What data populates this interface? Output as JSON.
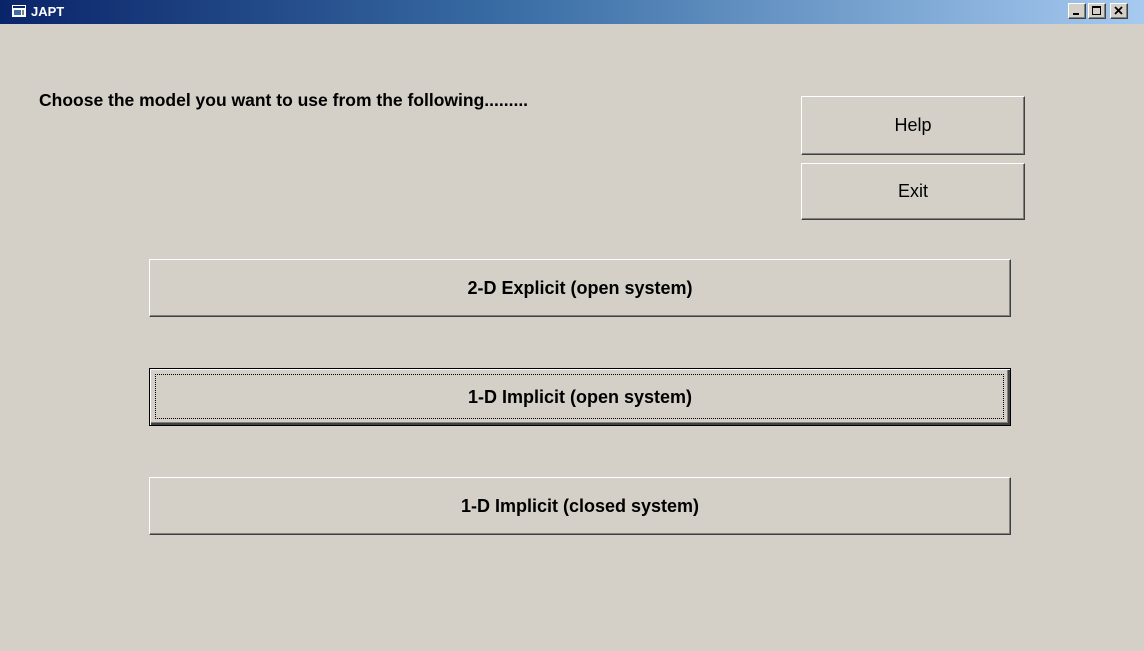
{
  "window": {
    "title": "JAPT",
    "controls": {
      "minimize_icon": "minimize-icon",
      "maximize_icon": "maximize-icon",
      "close_icon": "close-icon"
    }
  },
  "main": {
    "prompt": "Choose the model you want to use from the following.........",
    "help_label": "Help",
    "exit_label": "Exit",
    "models": [
      "2-D Explicit (open system)",
      "1-D Implicit (open system)",
      "1-D Implicit (closed system)"
    ],
    "focused_model": "1-D Implicit (open system)"
  },
  "colors": {
    "face": "#d4d0c8",
    "title_start": "#0a246a",
    "title_end": "#a6caf0"
  }
}
